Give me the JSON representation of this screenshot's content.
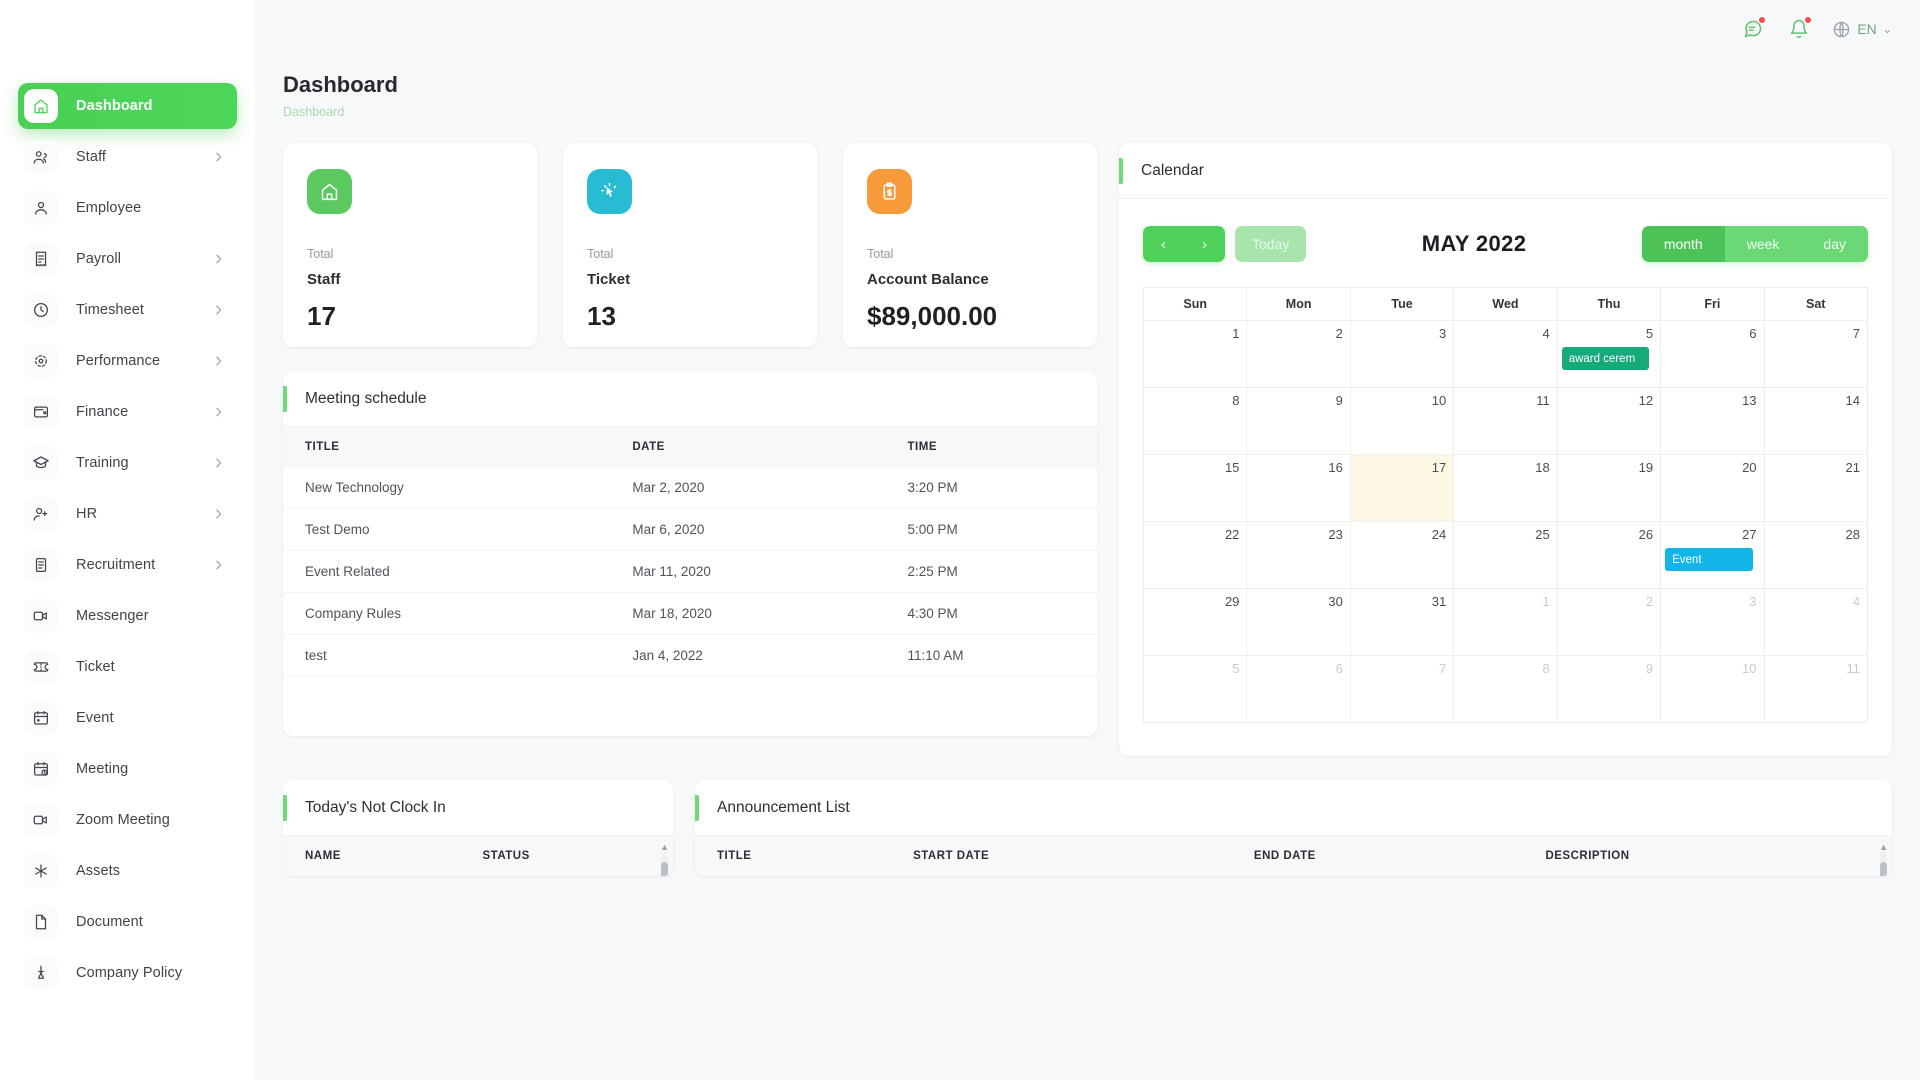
{
  "topbar": {
    "message_icon": "message-icon",
    "bell_icon": "bell-icon",
    "globe_icon": "globe-icon",
    "language": "EN",
    "caret": "⌄"
  },
  "sidebar": {
    "items": [
      {
        "label": "Dashboard",
        "icon": "home-icon",
        "active": true,
        "chevron": false
      },
      {
        "label": "Staff",
        "icon": "users-icon",
        "active": false,
        "chevron": true
      },
      {
        "label": "Employee",
        "icon": "user-icon",
        "active": false,
        "chevron": false
      },
      {
        "label": "Payroll",
        "icon": "receipt-icon",
        "active": false,
        "chevron": true
      },
      {
        "label": "Timesheet",
        "icon": "clock-icon",
        "active": false,
        "chevron": true
      },
      {
        "label": "Performance",
        "icon": "target-icon",
        "active": false,
        "chevron": true
      },
      {
        "label": "Finance",
        "icon": "wallet-icon",
        "active": false,
        "chevron": true
      },
      {
        "label": "Training",
        "icon": "graduation-icon",
        "active": false,
        "chevron": true
      },
      {
        "label": "HR",
        "icon": "user-plus-icon",
        "active": false,
        "chevron": true
      },
      {
        "label": "Recruitment",
        "icon": "scroll-icon",
        "active": false,
        "chevron": true
      },
      {
        "label": "Messenger",
        "icon": "video-icon",
        "active": false,
        "chevron": false
      },
      {
        "label": "Ticket",
        "icon": "ticket-icon",
        "active": false,
        "chevron": false
      },
      {
        "label": "Event",
        "icon": "calendar-icon",
        "active": false,
        "chevron": false
      },
      {
        "label": "Meeting",
        "icon": "calendar-clock-icon",
        "active": false,
        "chevron": false
      },
      {
        "label": "Zoom Meeting",
        "icon": "video-icon",
        "active": false,
        "chevron": false
      },
      {
        "label": "Assets",
        "icon": "asterisk-icon",
        "active": false,
        "chevron": false
      },
      {
        "label": "Document",
        "icon": "document-icon",
        "active": false,
        "chevron": false
      },
      {
        "label": "Company Policy",
        "icon": "policy-icon",
        "active": false,
        "chevron": false
      }
    ]
  },
  "header": {
    "title": "Dashboard",
    "breadcrumb": "Dashboard"
  },
  "stats": [
    {
      "total_label": "Total",
      "name": "Staff",
      "value": "17",
      "icon": "home-icon",
      "color": "#5bc95f"
    },
    {
      "total_label": "Total",
      "name": "Ticket",
      "value": "13",
      "icon": "cursor-icon",
      "color": "#28bcd4"
    },
    {
      "total_label": "Total",
      "name": "Account Balance",
      "value": "$89,000.00",
      "icon": "clipboard-icon",
      "color": "#f79a3a"
    }
  ],
  "meeting_schedule": {
    "title": "Meeting schedule",
    "columns": [
      "TITLE",
      "DATE",
      "TIME"
    ],
    "rows": [
      {
        "title": "New Technology",
        "date": "Mar 2, 2020",
        "time": "3:20 PM"
      },
      {
        "title": "Test Demo",
        "date": "Mar 6, 2020",
        "time": "5:00 PM"
      },
      {
        "title": "Event Related",
        "date": "Mar 11, 2020",
        "time": "2:25 PM"
      },
      {
        "title": "Company Rules",
        "date": "Mar 18, 2020",
        "time": "4:30 PM"
      },
      {
        "title": "test",
        "date": "Jan 4, 2022",
        "time": "11:10 AM"
      }
    ]
  },
  "calendar": {
    "title": "Calendar",
    "prev_label": "‹",
    "next_label": "›",
    "today_label": "Today",
    "month_title": "MAY 2022",
    "views": [
      {
        "label": "month",
        "active": true
      },
      {
        "label": "week",
        "active": false
      },
      {
        "label": "day",
        "active": false
      }
    ],
    "weekdays": [
      "Sun",
      "Mon",
      "Tue",
      "Wed",
      "Thu",
      "Fri",
      "Sat"
    ],
    "today_date": 17,
    "weeks": [
      [
        {
          "n": "1",
          "other": false
        },
        {
          "n": "2",
          "other": false
        },
        {
          "n": "3",
          "other": false
        },
        {
          "n": "4",
          "other": false
        },
        {
          "n": "5",
          "other": false,
          "event": {
            "label": "award cerem",
            "color": "#16a97a"
          }
        },
        {
          "n": "6",
          "other": false
        },
        {
          "n": "7",
          "other": false
        }
      ],
      [
        {
          "n": "8",
          "other": false
        },
        {
          "n": "9",
          "other": false
        },
        {
          "n": "10",
          "other": false
        },
        {
          "n": "11",
          "other": false
        },
        {
          "n": "12",
          "other": false
        },
        {
          "n": "13",
          "other": false
        },
        {
          "n": "14",
          "other": false
        }
      ],
      [
        {
          "n": "15",
          "other": false
        },
        {
          "n": "16",
          "other": false
        },
        {
          "n": "17",
          "other": false,
          "today": true
        },
        {
          "n": "18",
          "other": false
        },
        {
          "n": "19",
          "other": false
        },
        {
          "n": "20",
          "other": false
        },
        {
          "n": "21",
          "other": false
        }
      ],
      [
        {
          "n": "22",
          "other": false
        },
        {
          "n": "23",
          "other": false
        },
        {
          "n": "24",
          "other": false
        },
        {
          "n": "25",
          "other": false
        },
        {
          "n": "26",
          "other": false
        },
        {
          "n": "27",
          "other": false,
          "event": {
            "label": "Event",
            "color": "#12b5e5"
          }
        },
        {
          "n": "28",
          "other": false
        }
      ],
      [
        {
          "n": "29",
          "other": false
        },
        {
          "n": "30",
          "other": false
        },
        {
          "n": "31",
          "other": false
        },
        {
          "n": "1",
          "other": true
        },
        {
          "n": "2",
          "other": true
        },
        {
          "n": "3",
          "other": true
        },
        {
          "n": "4",
          "other": true
        }
      ],
      [
        {
          "n": "5",
          "other": true
        },
        {
          "n": "6",
          "other": true
        },
        {
          "n": "7",
          "other": true
        },
        {
          "n": "8",
          "other": true
        },
        {
          "n": "9",
          "other": true
        },
        {
          "n": "10",
          "other": true
        },
        {
          "n": "11",
          "other": true
        }
      ]
    ]
  },
  "not_clock_in": {
    "title": "Today's Not Clock In",
    "columns": [
      "NAME",
      "STATUS"
    ],
    "rows": []
  },
  "announcement": {
    "title": "Announcement List",
    "columns": [
      "TITLE",
      "START DATE",
      "END DATE",
      "DESCRIPTION"
    ],
    "rows": []
  }
}
